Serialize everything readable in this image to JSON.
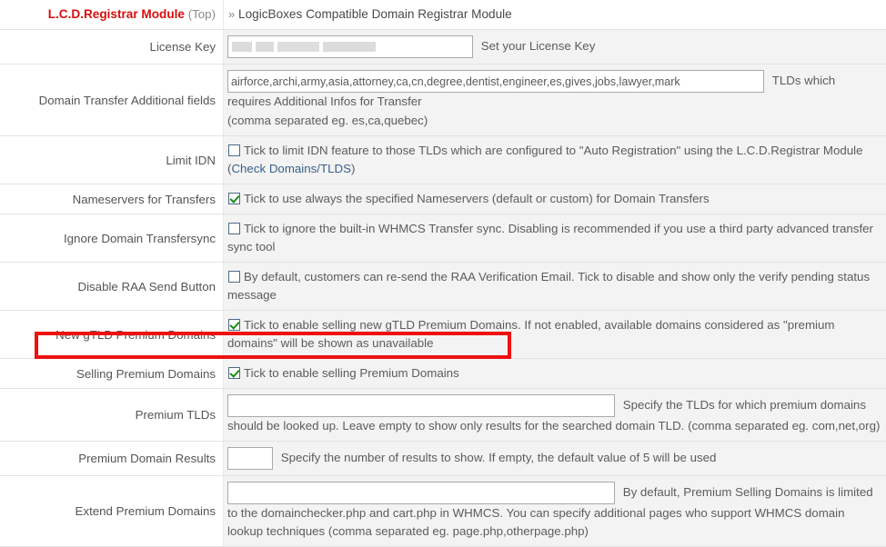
{
  "header": {
    "module_title": "L.C.D.Registrar Module",
    "top_suffix": "(Top)",
    "chevron": "»",
    "description": "LogicBoxes Compatible Domain Registrar Module"
  },
  "rows": [
    {
      "label": "License Key",
      "input_value": "",
      "note": "Set your License Key"
    },
    {
      "label": "Domain Transfer Additional fields",
      "input_value": "airforce,archi,army,asia,attorney,ca,cn,degree,dentist,engineer,es,gives,jobs,lawyer,mark",
      "note": "TLDs which requires Additional Infos for Transfer",
      "note2": "(comma separated eg. es,ca,quebec)"
    },
    {
      "label": "Limit IDN",
      "checked": false,
      "note": "Tick to limit IDN feature to those TLDs which are configured to \"Auto Registration\" using the L.C.D.Registrar Module (",
      "link": "Check Domains/TLDS",
      "note_tail": ")"
    },
    {
      "label": "Nameservers for Transfers",
      "checked": true,
      "note": "Tick to use always the specified Nameservers (default or custom) for Domain Transfers"
    },
    {
      "label": "Ignore Domain Transfersync",
      "checked": false,
      "note": "Tick to ignore the built-in WHMCS Transfer sync. Disabling is recommended if you use a third party advanced transfer sync tool"
    },
    {
      "label": "Disable RAA Send Button",
      "checked": false,
      "note": "By default, customers can re-send the RAA Verification Email. Tick to disable and show only the verify pending status message"
    },
    {
      "label": "New gTLD Premium Domains",
      "checked": true,
      "note": "Tick to enable selling new gTLD Premium Domains. If not enabled, available domains considered as \"premium domains\" will be shown as unavailable"
    },
    {
      "label": "Selling Premium Domains",
      "checked": true,
      "note": "Tick to enable selling Premium Domains",
      "highlighted": true
    },
    {
      "label": "Premium TLDs",
      "input_value": "",
      "note": "Specify the TLDs for which premium domains should be looked up. Leave empty to show only results for the searched domain TLD. (comma separated eg. com,net,org)"
    },
    {
      "label": "Premium Domain Results",
      "input_value": "",
      "note": "Specify the number of results to show. If empty, the default value of 5 will be used"
    },
    {
      "label": "Extend Premium Domains",
      "input_value": "",
      "note": "By default, Premium Selling Domains is limited to the domainchecker.php and cart.php in WHMCS. You can specify additional pages who support WHMCS domain lookup techniques (comma separated eg. page.php,otherpage.php)"
    }
  ],
  "colors": {
    "module_title": "#d80f0f",
    "highlight": "#ee1111",
    "link": "#3a5f8a",
    "field_bg": "#f3f3f3",
    "checkbox_tick": "#1a8a1a"
  }
}
